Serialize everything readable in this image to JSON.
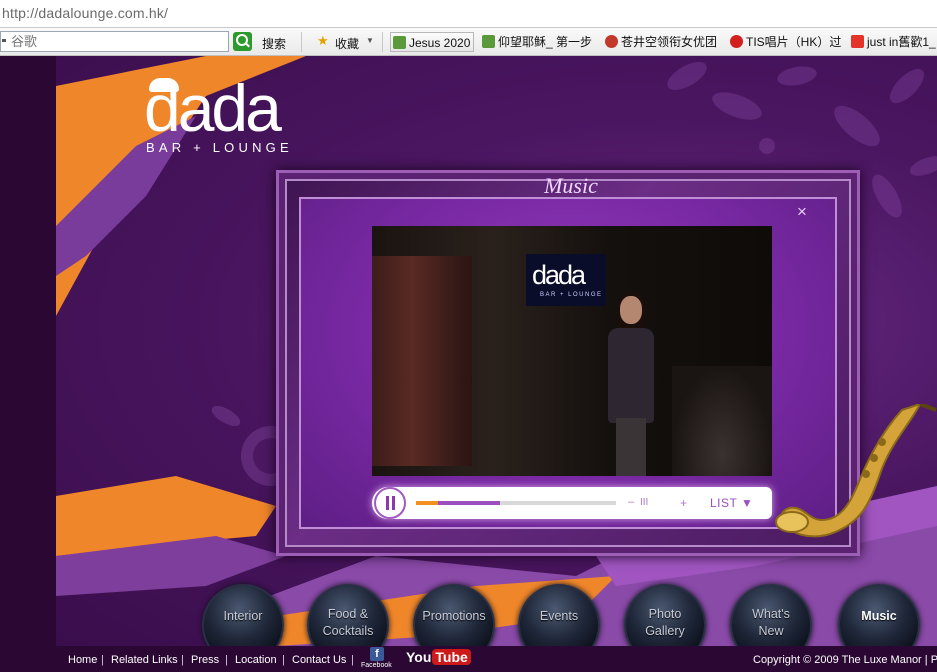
{
  "browser": {
    "url": "http://dadalounge.com.hk/",
    "search_placeholder": "谷歌",
    "search_button_label": "搜索",
    "favorites_label": "收藏",
    "bookmarks": [
      {
        "label": "Jesus 2020"
      },
      {
        "label": "仰望耶稣_ 第一步"
      },
      {
        "label": "苍井空领衔女优团"
      },
      {
        "label": "TIS唱片（HK）过"
      },
      {
        "label": "just in舊歡1_"
      }
    ]
  },
  "site": {
    "logo_word": "dada",
    "logo_sub": "BAR + LOUNGE",
    "frame_title": "Music",
    "close_symbol": "×",
    "video": {
      "sign_word": "dada",
      "sign_sub": "BAR + LOUNGE"
    },
    "player": {
      "progress_fraction": 0.42,
      "played_fraction": 0.11,
      "vol_minus": "–",
      "vol_bars": "III",
      "vol_plus": "+",
      "list_label": "LIST ▼"
    },
    "nav": [
      {
        "label": "Interior"
      },
      {
        "label": "Food &\nCocktails"
      },
      {
        "label": "Promotions"
      },
      {
        "label": "Events"
      },
      {
        "label": "Photo\nGallery"
      },
      {
        "label": "What's\nNew"
      },
      {
        "label": "Music",
        "active": true
      }
    ],
    "footer": {
      "links": [
        "Home",
        "Related Links",
        "Press",
        "Location",
        "Contact Us"
      ],
      "separator": "|",
      "facebook_label": "Facebook",
      "youtube_you": "You",
      "youtube_tube": "Tube",
      "copyright": "Copyright © 2009 The Luxe Manor | Po"
    },
    "colors": {
      "background": "#320c3e",
      "accent_orange": "#f39020",
      "accent_purple": "#9a3ec0"
    }
  }
}
